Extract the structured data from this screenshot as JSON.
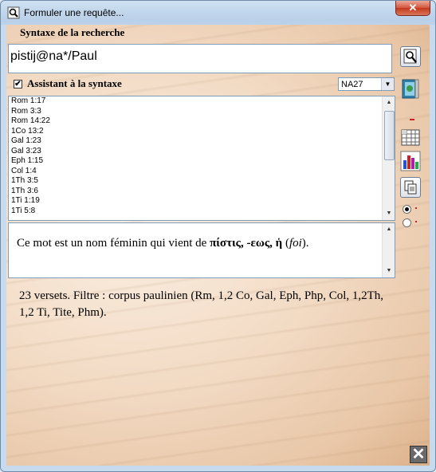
{
  "window": {
    "title": "Formuler une requête...",
    "close_glyph": "✕"
  },
  "search": {
    "syntax_label": "Syntaxe de la recherche",
    "query_value": "pistij@na*/Paul"
  },
  "assistant": {
    "checked": true,
    "check_glyph": "✔",
    "label": "Assistant à la syntaxe",
    "edition_value": "NA27"
  },
  "references": [
    "Rom 1:17",
    "Rom 3:3",
    "Rom 14:22",
    "1Co 13:2",
    "Gal 1:23",
    "Gal 3:23",
    "Eph 1:15",
    "Col 1:4",
    "1Th 3:5",
    "1Th 3:6",
    "1Ti 1:19",
    "1Ti 5:8"
  ],
  "description": {
    "prefix": "Ce mot est un nom féminin qui vient de ",
    "lemma": "πίστις, -εως, ἡ",
    "gloss": "foi",
    "open_paren": " (",
    "close_paren": ")."
  },
  "result": {
    "text": "23 versets. Filtre : corpus paulinien (Rm, 1,2 Co, Gal, Eph, Php, Col, 1,2Th, 1,2 Ti, Tite, Phm)."
  },
  "toolbar_icons": [
    "search-icon",
    "gospel-book-icon",
    "grid-table-icon",
    "bar-chart-icon",
    "copy-icon",
    "close-icon"
  ],
  "colors": {
    "accent_red": "#d02020",
    "input_border": "#7f9db9",
    "parchment": "#f3dcc6"
  }
}
